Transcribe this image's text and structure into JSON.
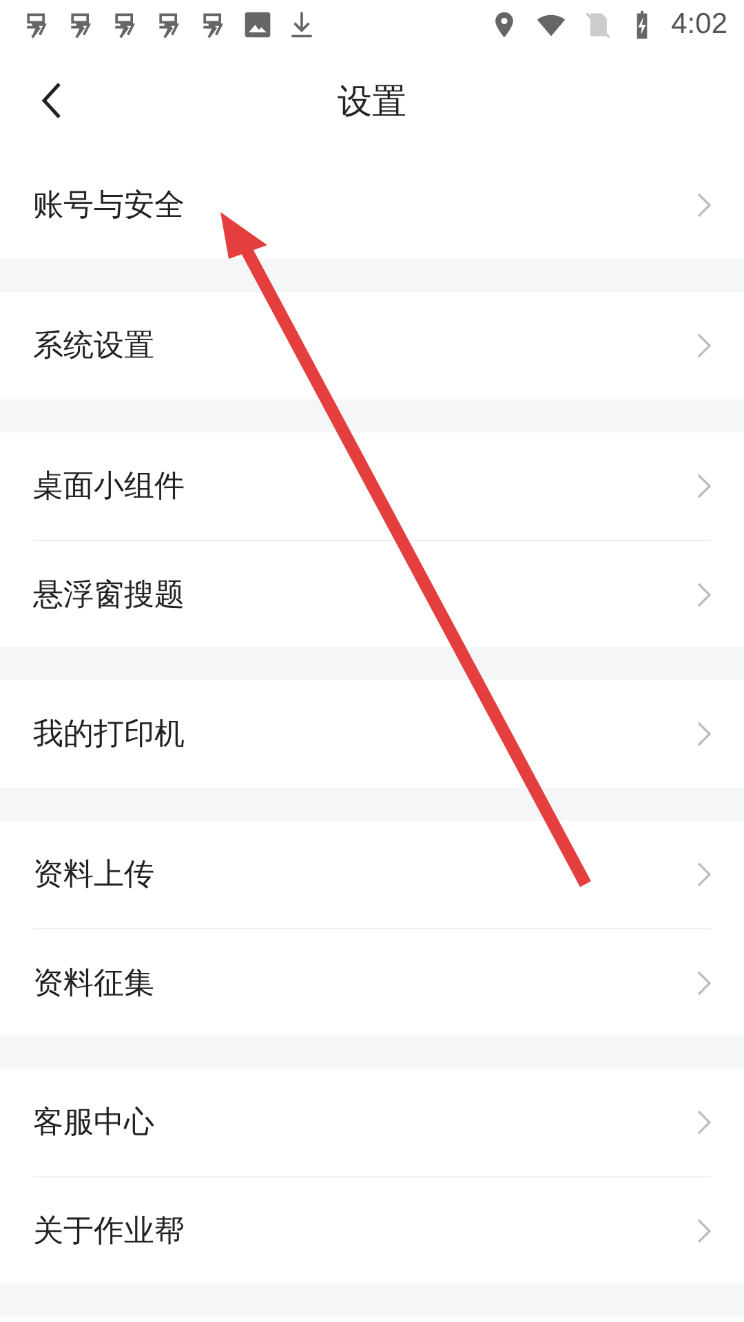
{
  "status_bar": {
    "time": "4:02"
  },
  "header": {
    "title": "设置"
  },
  "sections": [
    {
      "items": [
        {
          "label": "账号与安全"
        }
      ]
    },
    {
      "items": [
        {
          "label": "系统设置"
        }
      ]
    },
    {
      "items": [
        {
          "label": "桌面小组件"
        },
        {
          "label": "悬浮窗搜题"
        }
      ]
    },
    {
      "items": [
        {
          "label": "我的打印机"
        }
      ]
    },
    {
      "items": [
        {
          "label": "资料上传"
        },
        {
          "label": "资料征集"
        }
      ]
    },
    {
      "items": [
        {
          "label": "客服中心"
        },
        {
          "label": "关于作业帮"
        }
      ]
    }
  ]
}
